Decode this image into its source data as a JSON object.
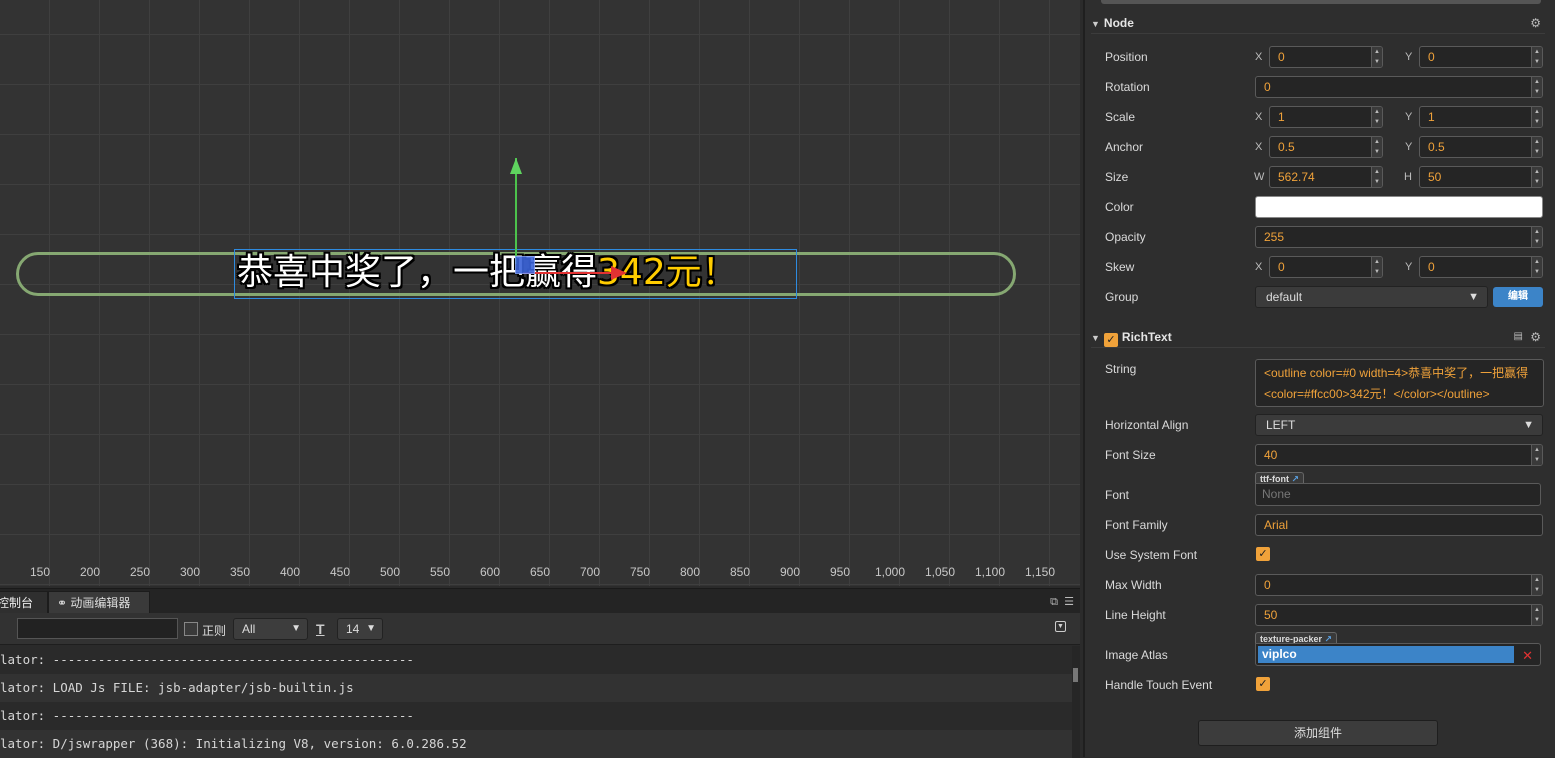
{
  "scene": {
    "ruler_labels": [
      "150",
      "200",
      "250",
      "300",
      "350",
      "400",
      "450",
      "500",
      "550",
      "600",
      "650",
      "700",
      "750",
      "800",
      "850",
      "900",
      "950",
      "1,000",
      "1,050",
      "1,100",
      "1,150"
    ],
    "richtext_normal": "恭喜中奖了，一把赢得",
    "richtext_highlight": "342元！",
    "highlight_color": "#ffcc00"
  },
  "console": {
    "tabs": {
      "console": "控制台",
      "animation": "动画编辑器"
    },
    "search_value": "",
    "regex_label": "正则",
    "level_select": "All",
    "font_size_select": "14",
    "log_lines": [
      "lator: ------------------------------------------------",
      "lator: LOAD Js FILE: jsb-adapter/jsb-builtin.js",
      "lator: ------------------------------------------------",
      "lator: D/jswrapper (368): Initializing V8, version: 6.0.286.52"
    ]
  },
  "inspector": {
    "node": {
      "title": "Node",
      "position": {
        "label": "Position",
        "x": "0",
        "y": "0"
      },
      "rotation": {
        "label": "Rotation",
        "value": "0"
      },
      "scale": {
        "label": "Scale",
        "x": "1",
        "y": "1"
      },
      "anchor": {
        "label": "Anchor",
        "x": "0.5",
        "y": "0.5"
      },
      "size": {
        "label": "Size",
        "w": "562.74",
        "h": "50"
      },
      "color": {
        "label": "Color",
        "value": "#ffffff"
      },
      "opacity": {
        "label": "Opacity",
        "value": "255"
      },
      "skew": {
        "label": "Skew",
        "x": "0",
        "y": "0"
      },
      "group": {
        "label": "Group",
        "value": "default",
        "edit_button": "编辑"
      }
    },
    "axis": {
      "x": "X",
      "y": "Y",
      "w": "W",
      "h": "H"
    },
    "richtext": {
      "title": "RichText",
      "enabled": true,
      "string": {
        "label": "String",
        "value": "<outline color=#0  width=4>恭喜中奖了，一把赢得<color=#ffcc00>342元！</color></outline>"
      },
      "horizontal_align": {
        "label": "Horizontal Align",
        "value": "LEFT"
      },
      "font_size": {
        "label": "Font Size",
        "value": "40"
      },
      "font": {
        "label": "Font",
        "tag": "ttf-font",
        "value": "None"
      },
      "font_family": {
        "label": "Font Family",
        "value": "Arial"
      },
      "use_system_font": {
        "label": "Use System Font",
        "checked": true
      },
      "max_width": {
        "label": "Max Width",
        "value": "0"
      },
      "line_height": {
        "label": "Line Height",
        "value": "50"
      },
      "image_atlas": {
        "label": "Image Atlas",
        "tag": "texture-packer",
        "value": "viplco"
      },
      "handle_touch_event": {
        "label": "Handle Touch Event",
        "checked": true
      }
    },
    "add_component": "添加组件"
  },
  "colors": {
    "accent": "#f0a23a",
    "selection": "#3c84c8",
    "scene_bg": "#333333"
  }
}
